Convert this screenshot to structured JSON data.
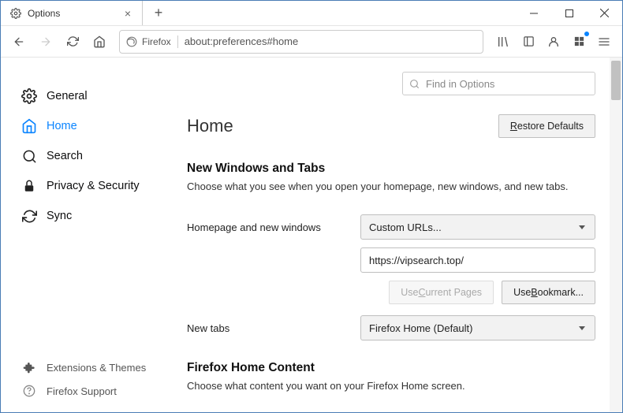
{
  "window": {
    "tab_title": "Options",
    "url_label": "Firefox",
    "url": "about:preferences#home"
  },
  "sidebar": {
    "items": [
      {
        "label": "General"
      },
      {
        "label": "Home"
      },
      {
        "label": "Search"
      },
      {
        "label": "Privacy & Security"
      },
      {
        "label": "Sync"
      }
    ],
    "bottom": [
      {
        "label": "Extensions & Themes"
      },
      {
        "label": "Firefox Support"
      }
    ]
  },
  "search": {
    "placeholder": "Find in Options"
  },
  "page": {
    "title": "Home",
    "restore_defaults": "Restore Defaults"
  },
  "section1": {
    "heading": "New Windows and Tabs",
    "subtext": "Choose what you see when you open your homepage, new windows, and new tabs.",
    "row1_label": "Homepage and new windows",
    "row1_select": "Custom URLs...",
    "row1_input": "https://vipsearch.top/",
    "btn_use_current": "Use Current Pages",
    "btn_use_bookmark": "Use Bookmark...",
    "row2_label": "New tabs",
    "row2_select": "Firefox Home (Default)"
  },
  "section2": {
    "heading": "Firefox Home Content",
    "subtext": "Choose what content you want on your Firefox Home screen."
  }
}
